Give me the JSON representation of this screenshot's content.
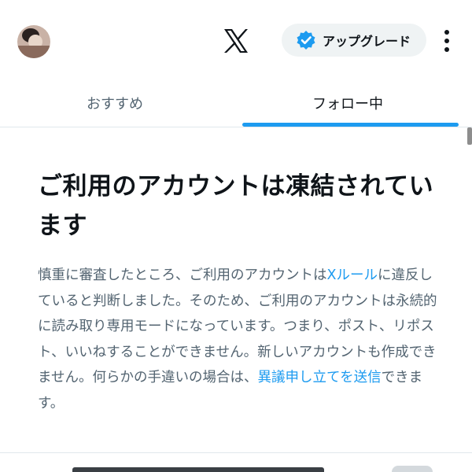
{
  "header": {
    "avatar_icon": "profile-photo",
    "logo_icon": "x-logo",
    "upgrade_label": "アップグレード",
    "upgrade_icon": "verified-badge-icon",
    "more_icon": "more-vertical-icon"
  },
  "tabs": [
    {
      "label": "おすすめ",
      "selected": false
    },
    {
      "label": "フォロー中",
      "selected": true
    }
  ],
  "notice": {
    "title": "ご利用のアカウントは凍結されています",
    "body_1": "慎重に審査したところ、ご利用のアカウントは",
    "rules_link": "Xルール",
    "body_2": "に違反していると判断しました。そのため、ご利用のアカウントは永続的に読み取り専用モードになっています。つまり、ポスト、リポスト、いいねすることができません。新しいアカウントも作成できません。何らかの手違いの場合は、",
    "appeal_link": "異議申し立てを送信",
    "body_3": "できます。"
  },
  "colors": {
    "accent": "#1d9bf0",
    "text_primary": "#0f1419",
    "text_secondary": "#536471",
    "pill_bg": "#eff3f4"
  }
}
